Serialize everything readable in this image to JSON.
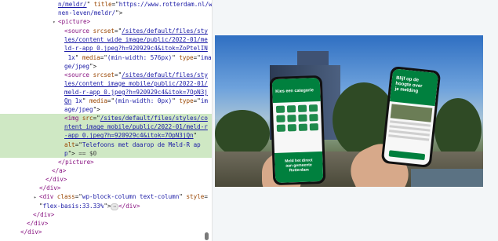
{
  "devtools": {
    "lines": [
      {
        "indent": 0,
        "parts": [
          [
            "link",
            "n/meldr/"
          ],
          [
            "txt",
            "\" "
          ],
          [
            "attr",
            "title"
          ],
          [
            "txt",
            "=\""
          ],
          [
            "val",
            "https://www.rotterdam.nl/wo"
          ]
        ]
      },
      {
        "indent": 0,
        "parts": [
          [
            "val",
            "nen-leven/meldr/"
          ],
          [
            "txt",
            "\">"
          ]
        ]
      },
      {
        "indent": 0,
        "tri": "▾",
        "parts": [
          [
            "tag",
            "<picture>"
          ]
        ]
      },
      {
        "indent": 1,
        "parts": [
          [
            "tag",
            "<source "
          ],
          [
            "attr",
            "srcset"
          ],
          [
            "txt",
            "=\""
          ],
          [
            "link",
            "/sites/default/files/sty"
          ]
        ]
      },
      {
        "indent": 1,
        "parts": [
          [
            "link",
            "les/content_wide_image/public/2022-01/me"
          ]
        ]
      },
      {
        "indent": 1,
        "parts": [
          [
            "link",
            "ld-r-app_0.jpeg?h=920929c4&itok=ZoPtelIN"
          ]
        ]
      },
      {
        "indent": 1,
        "parts": [
          [
            "val",
            " 1x"
          ],
          [
            "txt",
            "\" "
          ],
          [
            "attr",
            "media"
          ],
          [
            "txt",
            "=\""
          ],
          [
            "val",
            "(min-width: 576px)"
          ],
          [
            "txt",
            "\" "
          ],
          [
            "attr",
            "type"
          ],
          [
            "txt",
            "=\""
          ],
          [
            "val",
            "ima"
          ]
        ]
      },
      {
        "indent": 1,
        "parts": [
          [
            "val",
            "ge/jpeg"
          ],
          [
            "txt",
            "\">"
          ]
        ]
      },
      {
        "indent": 1,
        "parts": [
          [
            "tag",
            "<source "
          ],
          [
            "attr",
            "srcset"
          ],
          [
            "txt",
            "=\""
          ],
          [
            "link",
            "/sites/default/files/sty"
          ]
        ]
      },
      {
        "indent": 1,
        "parts": [
          [
            "link",
            "les/content_image_mobile/public/2022-01/"
          ]
        ]
      },
      {
        "indent": 1,
        "parts": [
          [
            "link",
            "meld-r-app_0.jpeg?h=920929c4&itok=7OpN3j"
          ]
        ]
      },
      {
        "indent": 1,
        "parts": [
          [
            "link",
            "Qn"
          ],
          [
            "val",
            " 1x"
          ],
          [
            "txt",
            "\" "
          ],
          [
            "attr",
            "media"
          ],
          [
            "txt",
            "=\""
          ],
          [
            "val",
            "(min-width: 0px)"
          ],
          [
            "txt",
            "\" "
          ],
          [
            "attr",
            "type"
          ],
          [
            "txt",
            "=\""
          ],
          [
            "val",
            "im"
          ]
        ]
      },
      {
        "indent": 1,
        "parts": [
          [
            "val",
            "age/jpeg"
          ],
          [
            "txt",
            "\">"
          ]
        ]
      },
      {
        "indent": 1,
        "hl": true,
        "parts": [
          [
            "tag",
            "<img "
          ],
          [
            "attr",
            "src"
          ],
          [
            "txt",
            "=\""
          ],
          [
            "link",
            "/sites/default/files/styles/co"
          ]
        ]
      },
      {
        "indent": 1,
        "hl": true,
        "parts": [
          [
            "link",
            "ntent_image_mobile/public/2022-01/meld-r"
          ]
        ]
      },
      {
        "indent": 1,
        "hl": true,
        "parts": [
          [
            "link",
            "-app_0.jpeg?h=920929c4&itok=7OpN3jQn"
          ],
          [
            "txt",
            "\""
          ]
        ]
      },
      {
        "indent": 1,
        "hl": true,
        "parts": [
          [
            "attr",
            "alt"
          ],
          [
            "txt",
            "=\""
          ],
          [
            "val",
            "Telefoons met daarop de Meld-R ap"
          ]
        ]
      },
      {
        "indent": 1,
        "hl": true,
        "parts": [
          [
            "val",
            "p"
          ],
          [
            "txt",
            "\"> "
          ],
          [
            "muted",
            "== $0"
          ]
        ]
      },
      {
        "indent": 0,
        "parts": [
          [
            "tag",
            "</picture>"
          ]
        ]
      },
      {
        "indent": -1,
        "parts": [
          [
            "tag",
            "</a>"
          ]
        ]
      },
      {
        "indent": -2,
        "parts": [
          [
            "tag",
            "</div>"
          ]
        ]
      },
      {
        "indent": -3,
        "parts": [
          [
            "tag",
            "</div>"
          ]
        ]
      },
      {
        "indent": -3,
        "tri": "▸",
        "parts": [
          [
            "tag",
            "<div "
          ],
          [
            "attr",
            "class"
          ],
          [
            "txt",
            "=\""
          ],
          [
            "val",
            "wp-block-column text-column"
          ],
          [
            "txt",
            "\" "
          ],
          [
            "attr",
            "style"
          ],
          [
            "txt",
            "="
          ]
        ]
      },
      {
        "indent": -3,
        "parts": [
          [
            "txt",
            "\""
          ],
          [
            "val",
            "flex-basis:33.33%"
          ],
          [
            "txt",
            "\">"
          ],
          [
            "ellipsis",
            "⋯"
          ],
          [
            "tag",
            "</div>"
          ]
        ]
      },
      {
        "indent": -4,
        "parts": [
          [
            "tag",
            "</div>"
          ]
        ]
      },
      {
        "indent": -5,
        "parts": [
          [
            "tag",
            "</div>"
          ]
        ]
      },
      {
        "indent": -6,
        "parts": [
          [
            "tag",
            "</div>"
          ]
        ]
      }
    ]
  },
  "preview": {
    "phone_left": {
      "header": "Kies een categorie",
      "footer_line1": "Meld het direct",
      "footer_line2": "aan gemeente",
      "footer_line3": "Rotterdam"
    },
    "phone_right": {
      "header_line1": "Blijf op de",
      "header_line2": "hoogte over",
      "header_line3": "je melding"
    }
  },
  "colors": {
    "highlight": "#cfe8c4",
    "tag": "#881280",
    "attr": "#994500",
    "value": "#1a1aa6",
    "brand_green": "#00803e"
  }
}
